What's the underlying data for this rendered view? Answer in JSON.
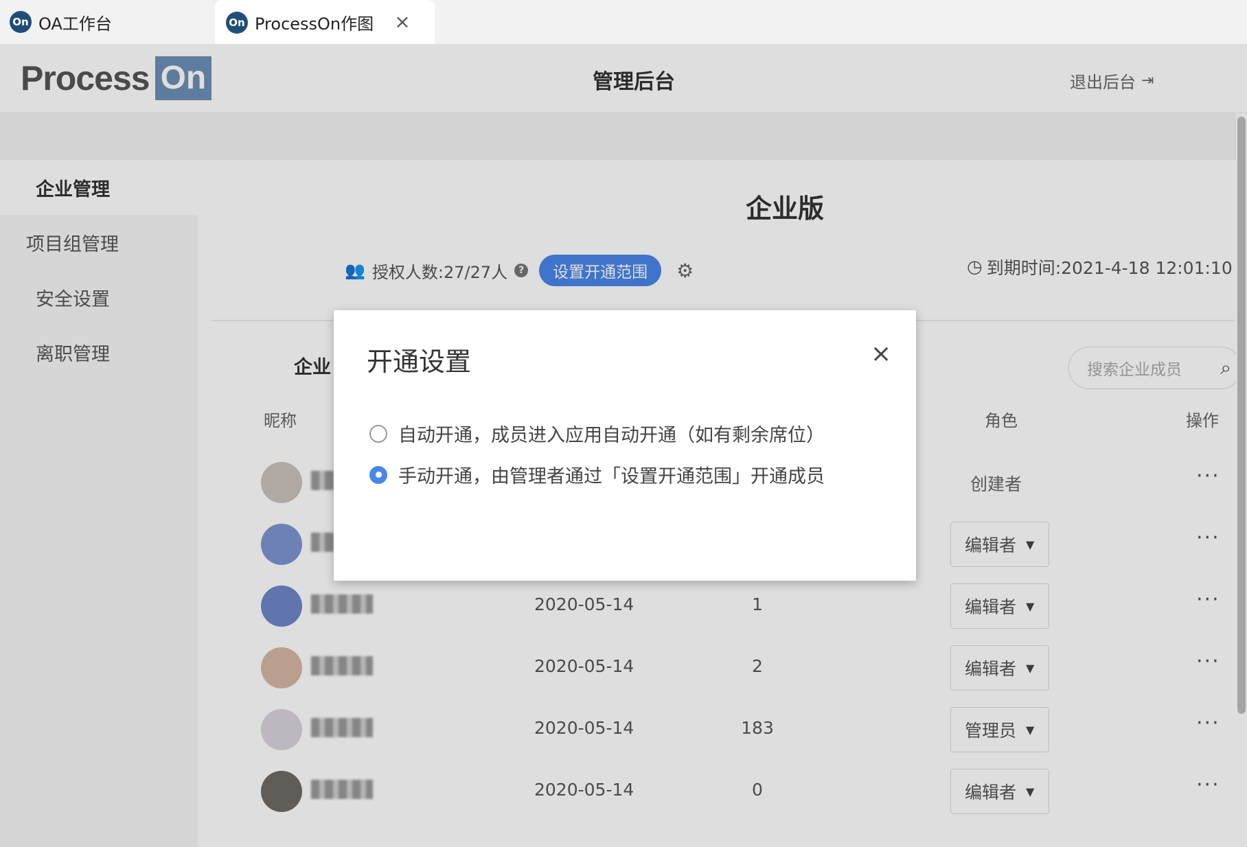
{
  "browser": {
    "tabs": [
      {
        "logo": "On",
        "label": "OA工作台"
      },
      {
        "logo": "On",
        "label": "ProcessOn作图",
        "close": "×"
      }
    ]
  },
  "header": {
    "brand_process": "Process",
    "brand_on": "On",
    "title": "管理后台",
    "logout": "退出后台"
  },
  "sidebar": {
    "items": [
      {
        "label": "企业管理"
      },
      {
        "label": "项目组管理"
      },
      {
        "label": "安全设置"
      },
      {
        "label": "离职管理"
      }
    ]
  },
  "main": {
    "edition": "企业版",
    "license": "授权人数:27/27人",
    "help": "?",
    "scope_button": "设置开通范围",
    "expire": "到期时间:2021-4-18 12:01:10",
    "members_label": "企业",
    "search_placeholder": "搜索企业成员",
    "columns": {
      "nickname": "昵称",
      "role": "角色",
      "action": "操作"
    },
    "rows": [
      {
        "date": "",
        "count": "",
        "role": "创建者",
        "role_type": "static",
        "avatar_color": "#c9c1bc"
      },
      {
        "date": "",
        "count": "",
        "role": "编辑者",
        "role_type": "select",
        "avatar_color": "#7e95d3"
      },
      {
        "date": "2020-05-14",
        "count": "1",
        "role": "编辑者",
        "role_type": "select",
        "avatar_color": "#6f86c8"
      },
      {
        "date": "2020-05-14",
        "count": "2",
        "role": "编辑者",
        "role_type": "select",
        "avatar_color": "#d7b7a4"
      },
      {
        "date": "2020-05-14",
        "count": "183",
        "role": "管理员",
        "role_type": "select",
        "avatar_color": "#d9d3dc"
      },
      {
        "date": "2020-05-14",
        "count": "0",
        "role": "编辑者",
        "role_type": "select",
        "avatar_color": "#6f6a66"
      }
    ],
    "more": "···"
  },
  "modal": {
    "title": "开通设置",
    "close": "×",
    "options": [
      {
        "label": "自动开通，成员进入应用自动开通（如有剩余席位）",
        "checked": false
      },
      {
        "label": "手动开通，由管理者通过「设置开通范围」开通成员",
        "checked": true
      }
    ]
  },
  "colors": {
    "accent": "#4a86e8",
    "brand_on": "#6d8fb5"
  }
}
